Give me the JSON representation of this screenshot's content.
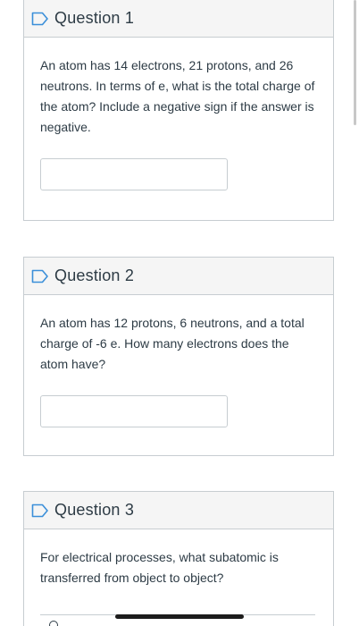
{
  "questions": [
    {
      "title": "Question 1",
      "text": "An atom has 14 electrons, 21 protons, and 26 neutrons.   In terms of e, what is the total charge of the atom? Include a negative sign if the answer is negative.",
      "answer_value": ""
    },
    {
      "title": "Question 2",
      "text": "An atom has 12 protons, 6 neutrons, and a total charge of -6 e.   How many electrons does the atom have?",
      "answer_value": ""
    },
    {
      "title": "Question 3",
      "text": "For electrical processes, what subatomic is transferred from object to object?"
    }
  ],
  "colors": {
    "flag_icon": "#3b8fd9",
    "text": "#2d3b45",
    "border": "#c7cdd1",
    "header_bg": "#f5f5f5"
  },
  "icons": {
    "flag": "flag-icon"
  }
}
